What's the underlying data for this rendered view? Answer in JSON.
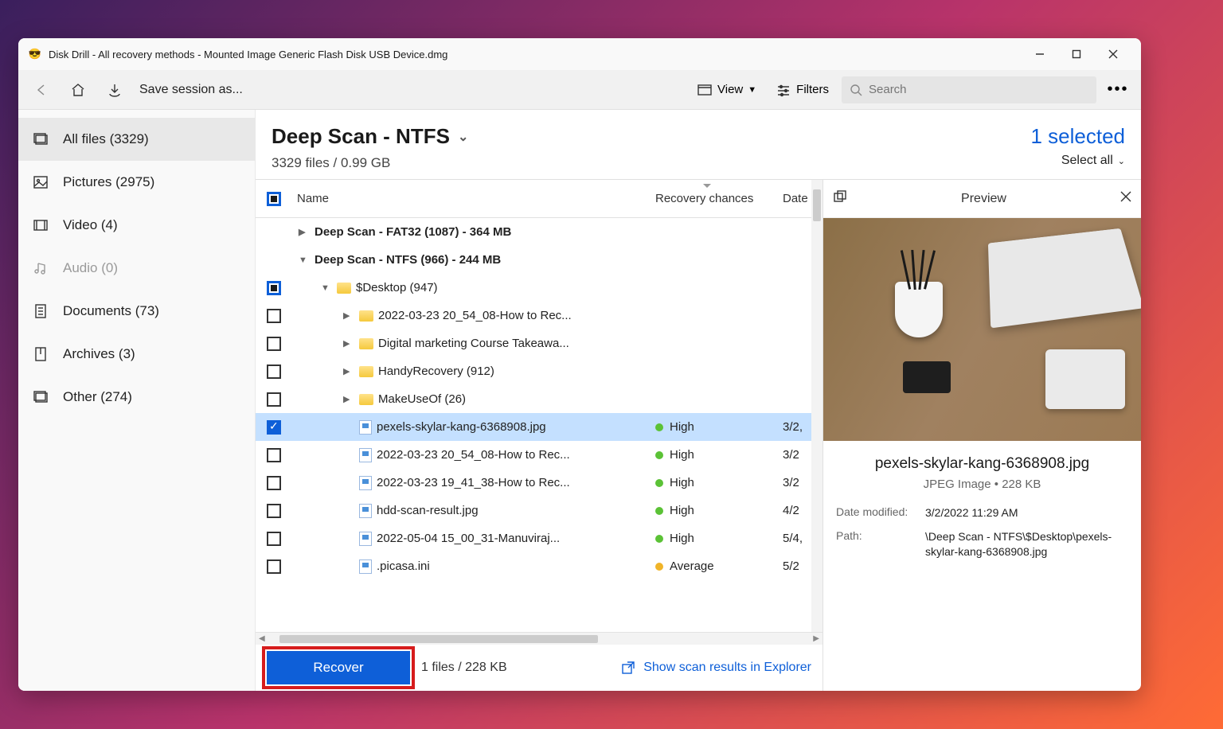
{
  "titlebar": {
    "title": "Disk Drill - All recovery methods - Mounted Image Generic Flash Disk USB Device.dmg"
  },
  "toolbar": {
    "save_label": "Save session as...",
    "view_label": "View",
    "filters_label": "Filters",
    "search_placeholder": "Search"
  },
  "sidebar": {
    "items": [
      {
        "label": "All files (3329)",
        "active": true
      },
      {
        "label": "Pictures (2975)"
      },
      {
        "label": "Video (4)"
      },
      {
        "label": "Audio (0)",
        "disabled": true
      },
      {
        "label": "Documents (73)"
      },
      {
        "label": "Archives (3)"
      },
      {
        "label": "Other (274)"
      }
    ]
  },
  "main": {
    "scan_title": "Deep Scan - NTFS",
    "scan_sub": "3329 files / 0.99 GB",
    "selected_count": "1 selected",
    "select_all": "Select all"
  },
  "columns": {
    "name": "Name",
    "recovery": "Recovery chances",
    "date": "Date"
  },
  "rows": [
    {
      "indent": 0,
      "check": "none",
      "expander": "▶",
      "icon": "",
      "name": "Deep Scan - FAT32 (1087) - 364 MB",
      "bold": true,
      "rec": "",
      "date": ""
    },
    {
      "indent": 0,
      "check": "none",
      "expander": "▼",
      "icon": "",
      "name": "Deep Scan - NTFS (966) - 244 MB",
      "bold": true,
      "rec": "",
      "date": ""
    },
    {
      "indent": 1,
      "check": "tri",
      "expander": "▼",
      "icon": "folder",
      "name": "$Desktop (947)",
      "rec": "",
      "date": ""
    },
    {
      "indent": 2,
      "check": "off",
      "expander": "▶",
      "icon": "folder",
      "name": "2022-03-23 20_54_08-How to Rec...",
      "rec": "",
      "date": ""
    },
    {
      "indent": 2,
      "check": "off",
      "expander": "▶",
      "icon": "folder",
      "name": "Digital marketing Course Takeawa...",
      "rec": "",
      "date": ""
    },
    {
      "indent": 2,
      "check": "off",
      "expander": "▶",
      "icon": "folder",
      "name": "HandyRecovery (912)",
      "rec": "",
      "date": ""
    },
    {
      "indent": 2,
      "check": "off",
      "expander": "▶",
      "icon": "folder",
      "name": "MakeUseOf (26)",
      "rec": "",
      "date": ""
    },
    {
      "indent": 2,
      "check": "on",
      "expander": "",
      "icon": "file",
      "name": "pexels-skylar-kang-6368908.jpg",
      "rec": "High",
      "date": "3/2,",
      "selected": true
    },
    {
      "indent": 2,
      "check": "off",
      "expander": "",
      "icon": "file",
      "name": "2022-03-23 20_54_08-How to Rec...",
      "rec": "High",
      "date": "3/2"
    },
    {
      "indent": 2,
      "check": "off",
      "expander": "",
      "icon": "file",
      "name": "2022-03-23 19_41_38-How to Rec...",
      "rec": "High",
      "date": "3/2"
    },
    {
      "indent": 2,
      "check": "off",
      "expander": "",
      "icon": "file",
      "name": "hdd-scan-result.jpg",
      "rec": "High",
      "date": "4/2"
    },
    {
      "indent": 2,
      "check": "off",
      "expander": "",
      "icon": "file",
      "name": "2022-05-04 15_00_31-Manuviraj...",
      "rec": "High",
      "date": "5/4,"
    },
    {
      "indent": 2,
      "check": "off",
      "expander": "",
      "icon": "file",
      "name": ".picasa.ini",
      "rec": "Average",
      "date": "5/2"
    }
  ],
  "footer": {
    "recover_label": "Recover",
    "info": "1 files / 228 KB",
    "explorer_link": "Show scan results in Explorer"
  },
  "preview": {
    "title": "Preview",
    "filename": "pexels-skylar-kang-6368908.jpg",
    "filetype": "JPEG Image • 228 KB",
    "date_label": "Date modified:",
    "date_value": "3/2/2022 11:29 AM",
    "path_label": "Path:",
    "path_value": "\\Deep Scan - NTFS\\$Desktop\\pexels-skylar-kang-6368908.jpg"
  }
}
